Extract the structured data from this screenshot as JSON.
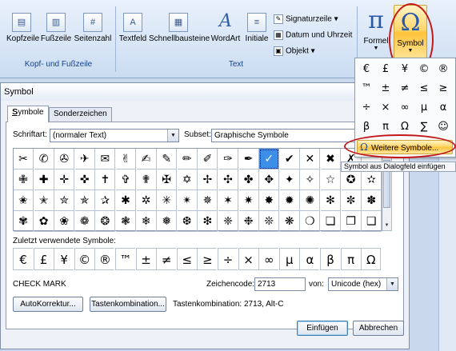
{
  "ribbon": {
    "groups": {
      "kopf": "Kopf- und Fußzeile",
      "text": "Text"
    },
    "buttons": {
      "kopfzeile": "Kopfzeile",
      "fusszeile": "Fußzeile",
      "seitenzahl": "Seitenzahl",
      "textfeld": "Textfeld",
      "schnellbausteine": "Schnellbausteine",
      "wordart": "WordArt",
      "initiale": "Initiale",
      "signaturzeile": "Signaturzeile",
      "datum": "Datum und Uhrzeit",
      "objekt": "Objekt",
      "formel": "Formel",
      "symbol": "Symbol"
    },
    "glyphs": {
      "formel": "π",
      "symbol": "Ω",
      "wordart": "A",
      "textfeld": "A"
    }
  },
  "dropdown": {
    "symbols": [
      "€",
      "£",
      "¥",
      "©",
      "®",
      "™",
      "±",
      "≠",
      "≤",
      "≥",
      "÷",
      "×",
      "∞",
      "µ",
      "α",
      "β",
      "π",
      "Ω",
      "∑",
      "☺"
    ],
    "more_label": "Weitere Symbole...",
    "more_glyph": "Ω"
  },
  "tooltip": "Symbol aus Dialogfeld einfügen",
  "dialog": {
    "title": "Symbol",
    "tabs": [
      "Symbole",
      "Sonderzeichen"
    ],
    "schriftart_label": "Schriftart:",
    "schriftart_value": "(normaler Text)",
    "subset_label": "Subset:",
    "subset_value": "Graphische Symbole",
    "grid": [
      [
        "✂",
        "✆",
        "✇",
        "✈",
        "✉",
        "✌",
        "✍",
        "✎",
        "✏",
        "✐",
        "✑",
        "✒",
        "✓",
        "✔",
        "✕",
        "✖",
        "✗"
      ],
      [
        "✙",
        "✚",
        "✛",
        "✜",
        "✝",
        "✞",
        "✟",
        "✠",
        "✡",
        "✢",
        "✣",
        "✤",
        "✥",
        "✦",
        "✧",
        "☆",
        "✪",
        "✫"
      ],
      [
        "✬",
        "✭",
        "✮",
        "✯",
        "✰",
        "✱",
        "✲",
        "✳",
        "✴",
        "✵",
        "✶",
        "✷",
        "✸",
        "✹",
        "✺",
        "✻",
        "✼",
        "✽"
      ],
      [
        "✾",
        "✿",
        "❀",
        "❁",
        "❂",
        "❃",
        "❄",
        "❅",
        "❆",
        "❇",
        "❈",
        "❉",
        "❊",
        "❋",
        "❍",
        "❏",
        "❐",
        "❑"
      ]
    ],
    "selected_index": [
      0,
      12
    ],
    "recent_label": "Zuletzt verwendete Symbole:",
    "recent": [
      "€",
      "£",
      "¥",
      "©",
      "®",
      "™",
      "±",
      "≠",
      "≤",
      "≥",
      "÷",
      "×",
      "∞",
      "µ",
      "α",
      "β",
      "π",
      "Ω"
    ],
    "char_name": "CHECK MARK",
    "zeichencode_label": "Zeichencode:",
    "zeichencode_value": "2713",
    "von_label": "von:",
    "von_value": "Unicode (hex)",
    "autokorrektur_label": "AutoKorrektur...",
    "tastenkombi_label": "Tastenkombination...",
    "tastenkombi_info": "Tastenkombination: 2713, Alt-C",
    "einfuegen_label": "Einfügen",
    "abbrechen_label": "Abbrechen"
  },
  "colors": {
    "ring": "#c21a1a",
    "selection": "#3d8ee6",
    "ribbon_label": "#15428b"
  }
}
